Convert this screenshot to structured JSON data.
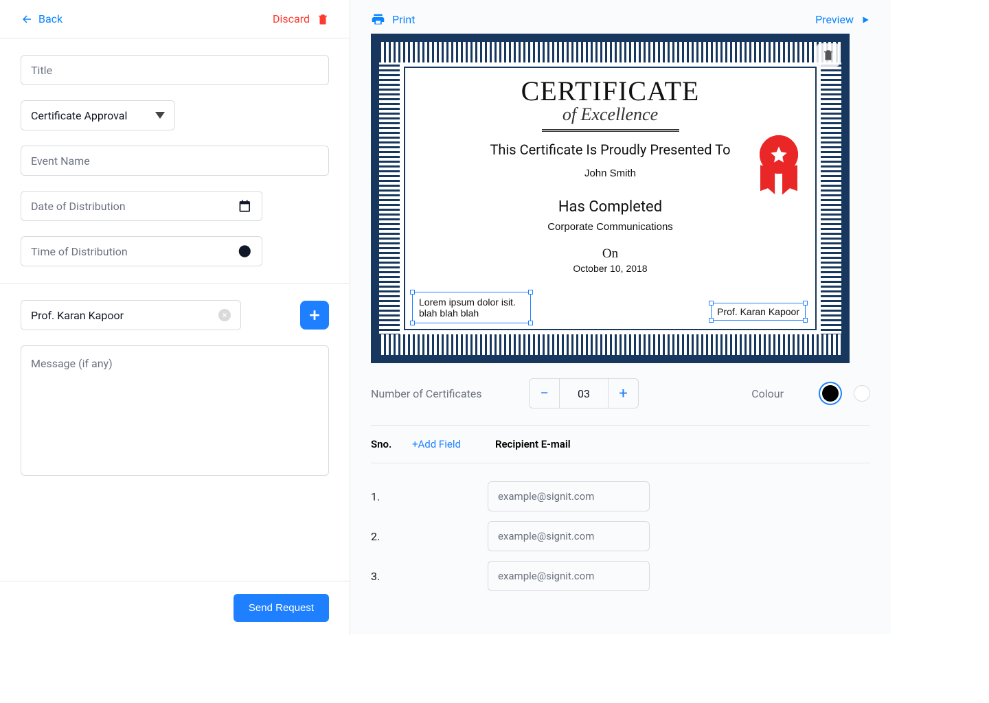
{
  "left": {
    "back_label": "Back",
    "discard_label": "Discard",
    "title_placeholder": "Title",
    "approval_selected": "Certificate Approval",
    "event_placeholder": "Event Name",
    "date_placeholder": "Date of Distribution",
    "time_placeholder": "Time of Distribution",
    "signee": "Prof. Karan Kapoor",
    "message_placeholder": "Message (if any)",
    "send_request_label": "Send Request"
  },
  "right": {
    "print_label": "Print",
    "preview_label": "Preview",
    "num_cert_label": "Number of Certificates",
    "num_cert_value": "03",
    "colour_label": "Colour"
  },
  "recipients": {
    "sno_header": "Sno.",
    "add_field_label": "+Add Field",
    "email_header": "Recipient E-mail",
    "rows": [
      {
        "num": "1.",
        "placeholder": "example@signit.com"
      },
      {
        "num": "2.",
        "placeholder": "example@signit.com"
      },
      {
        "num": "3.",
        "placeholder": "example@signit.com"
      }
    ]
  },
  "certificate": {
    "title": "CERTIFICATE",
    "subtitle": "of  Excellence",
    "presented": "This Certificate Is Proudly Presented To",
    "name": "John  Smith",
    "completed": "Has Completed",
    "topic": "Corporate Communications",
    "on": "On",
    "date": "October  10, 2018",
    "sel_text": "Lorem ipsum dolor isit. blah blah blah",
    "sel_prof": "Prof. Karan Kapoor"
  }
}
